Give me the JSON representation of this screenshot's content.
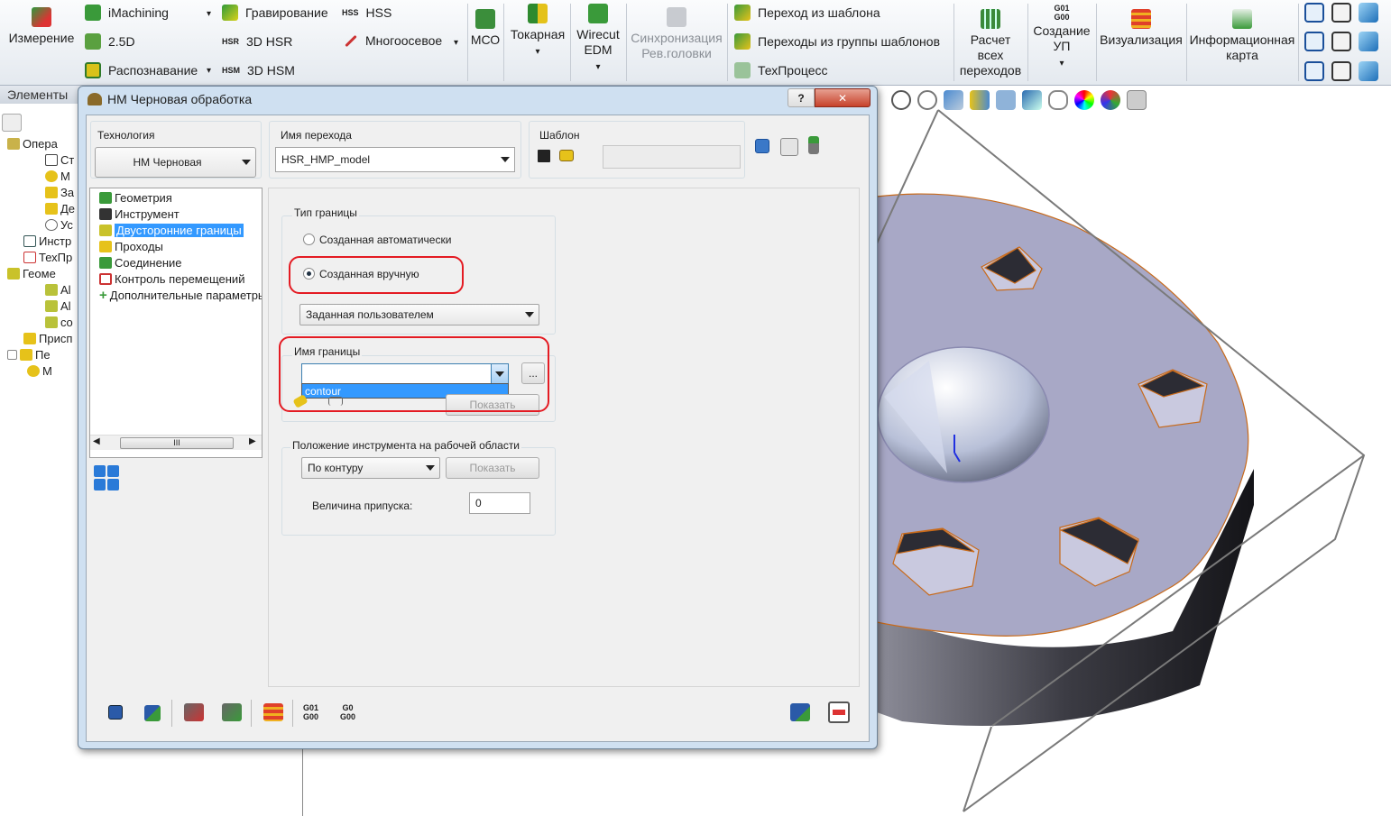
{
  "ribbon": {
    "izmerenie": "Измерение",
    "imachining": "iMachining",
    "gravirovanie": "Гравирование",
    "hss": "HSS",
    "d25": "2.5D",
    "hsr3d": "3D HSR",
    "mnogoosevoe": "Многоосевое",
    "raspoznavanie": "Распознавание",
    "hsm3d": "3D HSM",
    "mco": "МСО",
    "tokarnaya": "Токарная",
    "wirecut": "Wirecut",
    "edm": "EDM",
    "sinhr1": "Синхронизация",
    "sinhr2": "Рев.головки",
    "perehod_shablon": "Переход из шаблона",
    "perehody_gruppy": "Переходы из группы шаблонов",
    "tehprocess": "ТехПроцесс",
    "raschet1": "Расчет",
    "raschet2": "всех",
    "raschet3": "переходов",
    "g01": "G01",
    "g00": "G00",
    "sozdanie1": "Создание",
    "sozdanie2": "УП",
    "vizualizaciya": "Визуализация",
    "info1": "Информационная",
    "info2": "карта",
    "hss_icon": "HSS",
    "hsr_icon": "HSR",
    "hsm_icon": "HSM"
  },
  "leftpane": {
    "header": "Элементы",
    "items": [
      "Опера",
      "Ст",
      "М",
      "За",
      "Де",
      "Ус",
      "Инстр",
      "ТехПр",
      "Геоме",
      "Al",
      "Al",
      "co",
      "Присп",
      "Пе",
      "М"
    ]
  },
  "dialog": {
    "title": "НМ Черновая обработка",
    "help": "?",
    "close": "✕",
    "technology_label": "Технология",
    "technology_value": "НМ Черновая",
    "step_name_label": "Имя перехода",
    "step_name_value": "HSR_HMP_model",
    "template_label": "Шаблон",
    "nav": [
      "Геометрия",
      "Инструмент",
      "Двусторонние границы",
      "Проходы",
      "Соединение",
      "Контроль перемещений",
      "Дополнительные параметры"
    ],
    "boundary_type_label": "Тип границы",
    "radio_auto": "Созданная автоматически",
    "radio_manual": "Созданная вручную",
    "boundary_mode": "Заданная пользователем",
    "boundary_name_label": "Имя границы",
    "boundary_name_value": "",
    "browse": "...",
    "dropdown_option": "contour",
    "show1": "Показать",
    "tool_pos_label": "Положение инструмента на рабочей области",
    "tool_pos_value": "По контуру",
    "show2": "Показать",
    "allowance_label": "Величина припуска:",
    "allowance_value": "0",
    "scroll_thumb": "III",
    "g01": "G01",
    "g00": "G00",
    "g0": "G0",
    "g00b": "G00"
  }
}
